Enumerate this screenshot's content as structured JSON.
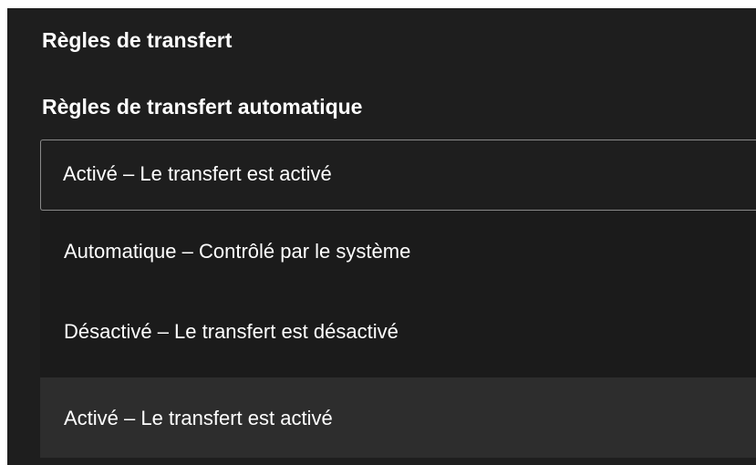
{
  "section": {
    "title": "Règles de transfert"
  },
  "field": {
    "label": "Règles de transfert automatique",
    "selected_value": "Activé – Le transfert est activé"
  },
  "dropdown": {
    "options": [
      {
        "label": "Automatique – Contrôlé par le système"
      },
      {
        "label": "Désactivé – Le transfert est désactivé"
      },
      {
        "label": "Activé – Le transfert est activé",
        "highlighted": true
      }
    ]
  },
  "colors": {
    "panel_background": "#1e1e1e",
    "dropdown_background": "#1b1b1b",
    "highlight_background": "#2d2d2d",
    "border": "#8a8a8a",
    "text": "#ffffff"
  }
}
